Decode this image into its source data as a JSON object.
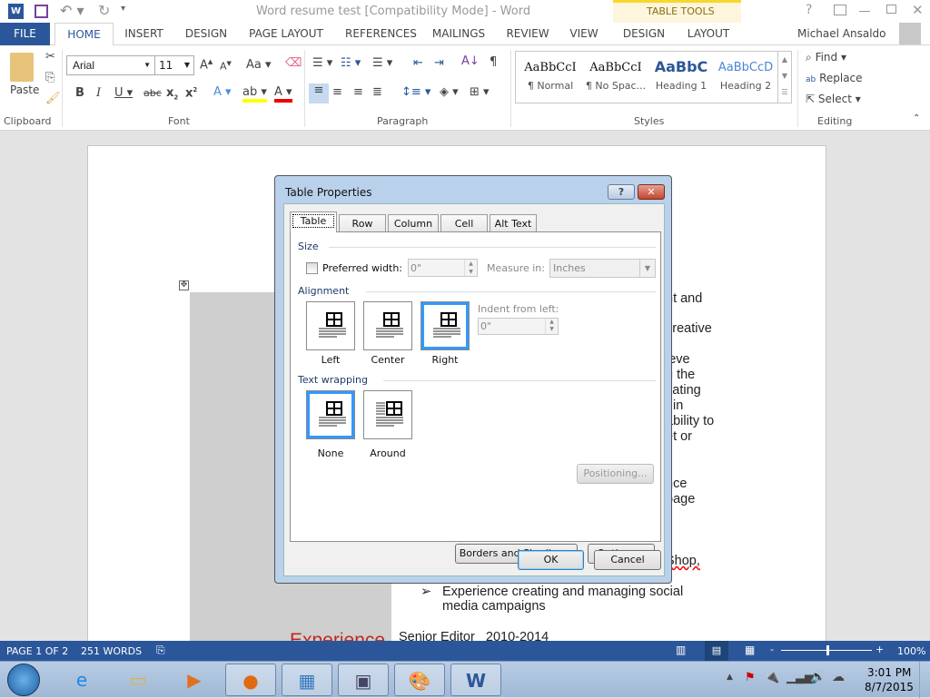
{
  "title": "Word resume test [Compatibility Mode] - Word",
  "contextual": {
    "label": "TABLE TOOLS",
    "color": "#f8d72a",
    "tabs": [
      "DESIGN",
      "LAYOUT"
    ]
  },
  "tabs": [
    "FILE",
    "HOME",
    "INSERT",
    "DESIGN",
    "PAGE LAYOUT",
    "REFERENCES",
    "MAILINGS",
    "REVIEW",
    "VIEW"
  ],
  "user": "Michael Ansaldo",
  "ribbon": {
    "clipboard": {
      "paste": "Paste",
      "label": "Clipboard"
    },
    "font": {
      "name": "Arial",
      "size": "11",
      "label": "Font",
      "aa": "Aa"
    },
    "paragraph": {
      "label": "Paragraph"
    },
    "styles": {
      "label": "Styles",
      "items": [
        {
          "preview": "AaBbCcI",
          "name": "¶ Normal"
        },
        {
          "preview": "AaBbCcI",
          "name": "¶ No Spac..."
        },
        {
          "preview": "AaBbC",
          "name": "Heading 1"
        },
        {
          "preview": "AaBbCcD",
          "name": "Heading 2"
        }
      ]
    },
    "editing": {
      "label": "Editing",
      "find": "Find",
      "replace": "Replace",
      "select": "Select"
    }
  },
  "document": {
    "fragments": [
      "nt and",
      "creative",
      "ieve",
      "g the",
      "vating",
      "t in",
      "ability to",
      "et or",
      "nce",
      "page",
      "Shop,"
    ],
    "bullet": [
      "Experience creating and managing social",
      "media campaigns"
    ],
    "heading": "Experience",
    "job": "Senior Editor   2010-2014"
  },
  "dialog": {
    "title": "Table Properties",
    "tabs": [
      "Table",
      "Row",
      "Column",
      "Cell",
      "Alt Text"
    ],
    "size_label": "Size",
    "preferred_width_label": "Preferred width:",
    "preferred_width_checked": false,
    "preferred_width_value": "0\"",
    "measure_in_label": "Measure in:",
    "measure_in_value": "Inches",
    "alignment_label": "Alignment",
    "alignment_options": [
      "Left",
      "Center",
      "Right"
    ],
    "alignment_selected": "Right",
    "indent_label": "Indent from left:",
    "indent_value": "0\"",
    "wrapping_label": "Text wrapping",
    "wrapping_options": [
      "None",
      "Around"
    ],
    "wrapping_selected": "None",
    "positioning": "Positioning...",
    "borders": "Borders and Shading...",
    "options": "Options...",
    "ok": "OK",
    "cancel": "Cancel"
  },
  "status": {
    "page": "PAGE 1 OF 2",
    "words": "251 WORDS",
    "zoom": "100%",
    "zoom_level": 100,
    "bg": "#2b579a"
  },
  "taskbar": {
    "time": "3:01 PM",
    "date": "8/7/2015"
  }
}
